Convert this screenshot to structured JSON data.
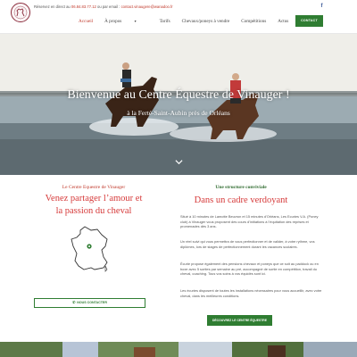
{
  "topbar": {
    "contact_prefix": "Réservez en direct au ",
    "phone": "06.84.83.77.12",
    "contact_middle": " ou par email : ",
    "email": "contact.vinaugere@wanadoo.fr"
  },
  "nav": {
    "items": [
      {
        "label": "Accueil",
        "active": true,
        "has_dropdown": false
      },
      {
        "label": "À propos",
        "active": false,
        "has_dropdown": true
      },
      {
        "label": "Tarifs",
        "active": false,
        "has_dropdown": false
      },
      {
        "label": "Chevaux/poneys à vendre",
        "active": false,
        "has_dropdown": false
      },
      {
        "label": "Compétitions",
        "active": false,
        "has_dropdown": false
      },
      {
        "label": "Actus",
        "active": false,
        "has_dropdown": false
      }
    ],
    "contact_button": "CONTACT"
  },
  "hero": {
    "title": "Bienvenue au Centre Équestre de Vinauger !",
    "subtitle": "à la Ferté-Saint-Aubin près de Orléans"
  },
  "intro": {
    "kicker": "Le Centre Equestre de Vinauger",
    "heading_line1": "Venez partager l’amour et",
    "heading_line2": "la passion du cheval",
    "contact_button": "NOUS CONTACTER"
  },
  "about": {
    "kicker": "Une structure conviviale",
    "heading": "Dans un cadre verdoyant",
    "paragraphs": [
      "Situé à 10 minutes de Lamotte Beuvron et 15 minutes d’Orléans, Les Ecuries V.A. (Poney club) à Vinauger vous proposent des cours d’initiations à l’équitation des reprises et promenades dès 3 ans.",
      "Un réel suivi qui vous permettra de vous perfectionner et de valider, à votre rythme, vos diplômes, lors de stages de perfectionnement durant les vacances scolaires.",
      "Écurie propose également des pensions chevaux et poneys que ce soit au paddock ou en boxe avec 5 sorties par semaine au pré, accompagné de sortie en compétition, travail du cheval, coaching. Tous vos soins à vos équidés sont ici.",
      "Les écuries disposent de toutes les installations nécessaires pour vous accueillir, avec votre cheval, dans les meilleures conditions."
    ],
    "discover_button": "DÉCOUVREZ LE CENTRE ÉQUESTRE"
  },
  "colors": {
    "accent_red": "#d63a3a",
    "brand_green": "#2f7d32"
  },
  "icons": {
    "social": "facebook-icon",
    "scroll": "chevron-down-icon",
    "phone": "phone-icon",
    "map_marker": "map-pin-icon"
  }
}
